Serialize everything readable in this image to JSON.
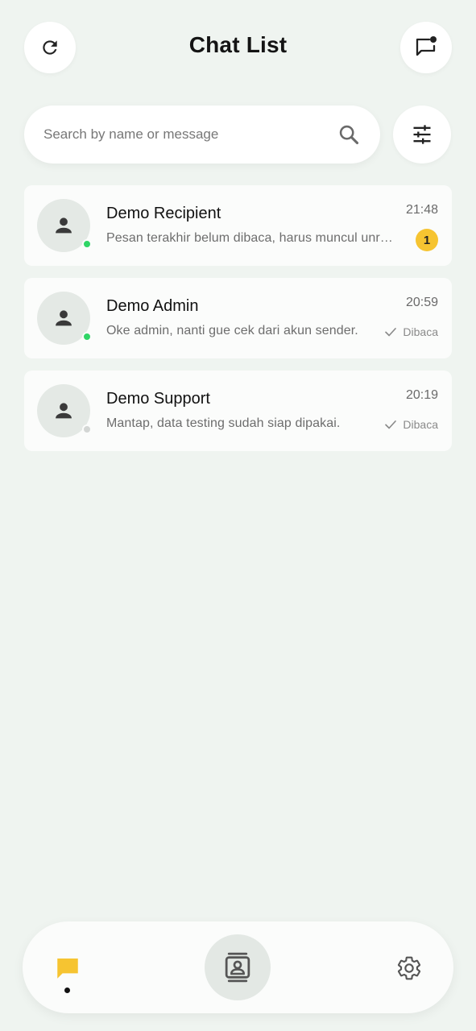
{
  "header": {
    "title": "Chat List"
  },
  "search": {
    "placeholder": "Search by name or message",
    "value": ""
  },
  "chats": [
    {
      "name": "Demo Recipient",
      "time": "21:48",
      "preview": "Pesan terakhir belum dibaca, harus muncul unread badge",
      "online": true,
      "unread": "1"
    },
    {
      "name": "Demo Admin",
      "time": "20:59",
      "preview": "Oke admin, nanti gue cek dari akun sender.",
      "online": true,
      "status": "Dibaca"
    },
    {
      "name": "Demo Support",
      "time": "20:19",
      "preview": "Mantap, data testing sudah siap dipakai.",
      "online": false,
      "status": "Dibaca"
    }
  ],
  "nav": {
    "items": [
      "chats-icon",
      "contacts-icon",
      "settings-icon"
    ],
    "active": "chats"
  },
  "colors": {
    "background": "#eff4f0",
    "accent": "#f6c431",
    "online": "#2fd566",
    "offline": "#d3d6d4",
    "icon_dark": "#3a3a3a"
  }
}
